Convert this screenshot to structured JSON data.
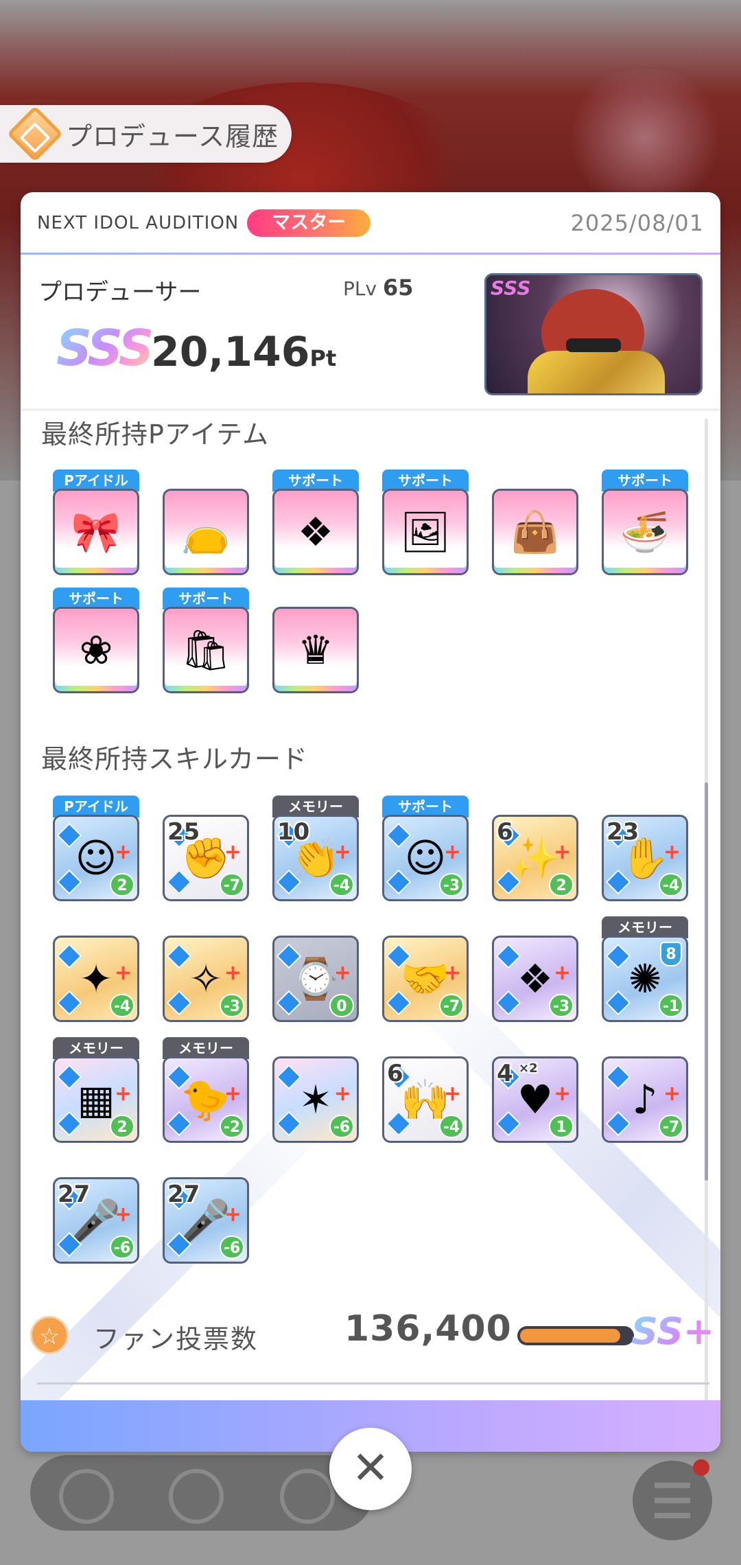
{
  "header": {
    "title": "プロデュース履歴",
    "icon": "history-diamond-icon"
  },
  "audition": {
    "name": "NEXT IDOL AUDITION",
    "rank_badge": "マスター",
    "date": "2025/08/01"
  },
  "producer": {
    "label": "プロデューサー",
    "plv_label": "PLv",
    "plv_value": "65",
    "rank": "SSS",
    "score": "20,146",
    "score_unit": "Pt",
    "thumbnail_rank": "SSS"
  },
  "p_items": {
    "title": "最終所持Pアイテム",
    "items": [
      {
        "tag": "Pアイドル",
        "icon": "bow-icon",
        "glyph": "🎀"
      },
      {
        "tag": "",
        "icon": "pouch-icon",
        "glyph": "👝"
      },
      {
        "tag": "サポート",
        "icon": "handkerchief-icon",
        "glyph": "❖"
      },
      {
        "tag": "サポート",
        "icon": "photo-frame-icon",
        "glyph": "🖼"
      },
      {
        "tag": "",
        "icon": "tote-bag-icon",
        "glyph": "👜"
      },
      {
        "tag": "サポート",
        "icon": "ramen-ticket-icon",
        "glyph": "🍜"
      },
      {
        "tag": "サポート",
        "icon": "flower-bookmark-icon",
        "glyph": "❀"
      },
      {
        "tag": "サポート",
        "icon": "shopping-bag-icon",
        "glyph": "🛍"
      },
      {
        "tag": "",
        "icon": "crown-cup-icon",
        "glyph": "♛"
      }
    ]
  },
  "skill_cards": {
    "title": "最終所持スキルカード",
    "cards": [
      {
        "tag": "Pアイドル",
        "num": "",
        "cost": "2",
        "icon": "idol-portrait-icon",
        "glyph": "☺",
        "style": "card-blue"
      },
      {
        "tag": "",
        "num": "25",
        "cost": "-7",
        "icon": "fist-icon",
        "glyph": "✊",
        "style": "card-white"
      },
      {
        "tag": "メモリー",
        "num": "10",
        "cost": "-4",
        "icon": "clapping-hands-icon",
        "glyph": "👏",
        "style": "card-blue"
      },
      {
        "tag": "サポート",
        "num": "",
        "cost": "-3",
        "icon": "support-portrait-icon",
        "glyph": "☺",
        "style": "card-blue"
      },
      {
        "tag": "",
        "num": "6",
        "cost": "2",
        "icon": "party-icon",
        "glyph": "✨",
        "style": "card-gold"
      },
      {
        "tag": "",
        "num": "23",
        "cost": "-4",
        "icon": "hand-wave-icon",
        "glyph": "✋",
        "style": "card-blue"
      },
      {
        "tag": "",
        "num": "",
        "cost": "-4",
        "icon": "sparkle-orb-icon",
        "glyph": "✦",
        "style": "card-gold"
      },
      {
        "tag": "",
        "num": "",
        "cost": "-3",
        "icon": "star-burst-icon",
        "glyph": "✧",
        "style": "card-gold"
      },
      {
        "tag": "",
        "num": "",
        "cost": "0",
        "icon": "clock-burst-icon",
        "glyph": "⌚",
        "style": "card-gray"
      },
      {
        "tag": "",
        "num": "",
        "cost": "-7",
        "icon": "handshake-icon",
        "glyph": "🤝",
        "style": "card-gold"
      },
      {
        "tag": "",
        "num": "",
        "cost": "-3",
        "icon": "wing-icon",
        "glyph": "❖",
        "style": "card-purple"
      },
      {
        "tag": "メモリー",
        "num": "",
        "cost": "-1",
        "icon": "spotlight-icon",
        "glyph": "✺",
        "style": "card-blue",
        "upgrade": "8"
      },
      {
        "tag": "メモリー",
        "num": "",
        "cost": "2",
        "icon": "stage-icon",
        "glyph": "▦",
        "style": "card-rainbow"
      },
      {
        "tag": "メモリー",
        "num": "",
        "cost": "-2",
        "icon": "mascot-icon",
        "glyph": "🐤",
        "style": "card-purple"
      },
      {
        "tag": "",
        "num": "",
        "cost": "-6",
        "icon": "hands-stars-icon",
        "glyph": "✶",
        "style": "card-rainbow"
      },
      {
        "tag": "",
        "num": "6",
        "cost": "-4",
        "icon": "praying-hands-icon",
        "glyph": "🙌",
        "style": "card-white"
      },
      {
        "tag": "",
        "num": "4",
        "cost": "1",
        "icon": "heart-icon",
        "glyph": "♥",
        "style": "card-purple",
        "extra": "×2"
      },
      {
        "tag": "",
        "num": "",
        "cost": "-7",
        "icon": "idol-dancer-icon",
        "glyph": "♪",
        "style": "card-purple"
      },
      {
        "tag": "",
        "num": "27",
        "cost": "-6",
        "icon": "microphone-icon",
        "glyph": "🎤",
        "style": "card-blue"
      },
      {
        "tag": "",
        "num": "27",
        "cost": "-6",
        "icon": "microphone-icon",
        "glyph": "🎤",
        "style": "card-blue"
      }
    ]
  },
  "fan_votes": {
    "label": "ファン投票数",
    "value": "136,400",
    "progress": 0.9,
    "rank": "SS+"
  },
  "close_label": "✕"
}
